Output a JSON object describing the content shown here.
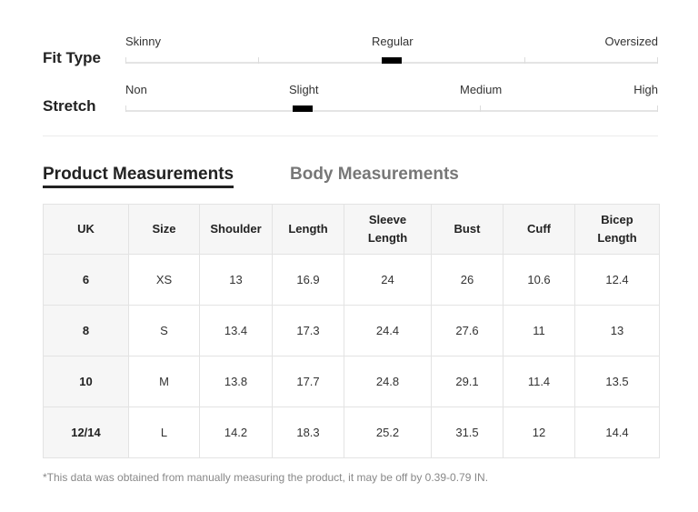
{
  "fit_type": {
    "title": "Fit Type",
    "labels": [
      "Skinny",
      "Regular",
      "Oversized"
    ],
    "selected": "Regular"
  },
  "stretch": {
    "title": "Stretch",
    "labels": [
      "Non",
      "Slight",
      "Medium",
      "High"
    ],
    "selected": "Slight"
  },
  "tabs": {
    "product": "Product Measurements",
    "body": "Body Measurements",
    "active": "product"
  },
  "table": {
    "headers": [
      "UK",
      "Size",
      "Shoulder",
      "Length",
      "Sleeve Length",
      "Bust",
      "Cuff",
      "Bicep Length"
    ],
    "rows": [
      [
        "6",
        "XS",
        "13",
        "16.9",
        "24",
        "26",
        "10.6",
        "12.4"
      ],
      [
        "8",
        "S",
        "13.4",
        "17.3",
        "24.4",
        "27.6",
        "11",
        "13"
      ],
      [
        "10",
        "M",
        "13.8",
        "17.7",
        "24.8",
        "29.1",
        "11.4",
        "13.5"
      ],
      [
        "12/14",
        "L",
        "14.2",
        "18.3",
        "25.2",
        "31.5",
        "12",
        "14.4"
      ]
    ]
  },
  "footnote": "*This data was obtained from manually measuring the product, it may be off by 0.39-0.79 IN."
}
